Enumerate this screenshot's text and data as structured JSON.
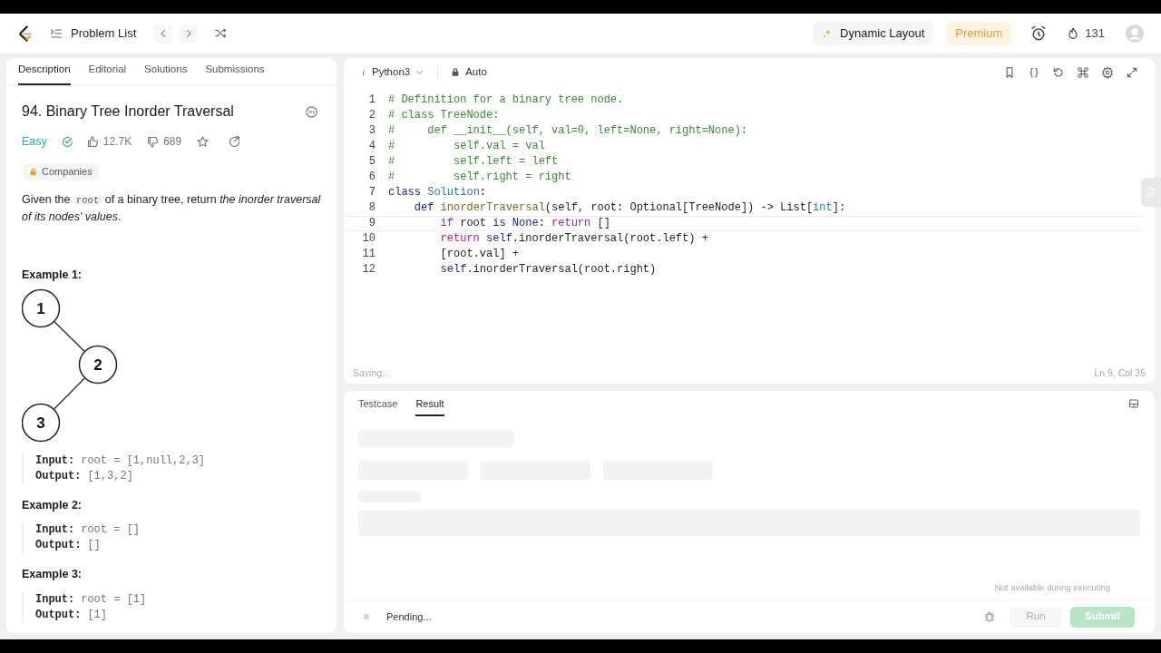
{
  "top_bar": {
    "problem_list": "Problem List",
    "dynamic_layout": "Dynamic Layout",
    "premium": "Premium",
    "streak": "131"
  },
  "description_panel": {
    "tabs": [
      {
        "label": "Description",
        "selected": true
      },
      {
        "label": "Editorial",
        "selected": false
      },
      {
        "label": "Solutions",
        "selected": false
      },
      {
        "label": "Submissions",
        "selected": false
      }
    ],
    "title": "94. Binary Tree Inorder Traversal",
    "difficulty": "Easy",
    "likes": "12.7K",
    "dislikes": "689",
    "companies": "Companies",
    "statement": [
      {
        "t": "Given the ",
        "kind": "text"
      },
      {
        "t": "root",
        "kind": "code"
      },
      {
        "t": " of a binary tree, return ",
        "kind": "text"
      },
      {
        "t": "the inorder traversal of its nodes' values",
        "kind": "italic"
      },
      {
        "t": ".",
        "kind": "text"
      }
    ],
    "examples": [
      {
        "heading": "Example 1:",
        "tree": [
          "1",
          "2",
          "3"
        ],
        "input_label": "Input:",
        "input": "root = [1,null,2,3]",
        "output_label": "Output:",
        "output": "[1,3,2]"
      },
      {
        "heading": "Example 2:",
        "input_label": "Input:",
        "input": "root = []",
        "output_label": "Output:",
        "output": "[]"
      },
      {
        "heading": "Example 3:",
        "input_label": "Input:",
        "input": "root = [1]",
        "output_label": "Output:",
        "output": "[1]"
      }
    ]
  },
  "editor": {
    "language": "Python3",
    "mode": "Auto",
    "lines": [
      {
        "number": "1",
        "active": false,
        "tokens": [
          {
            "t": "# Definition for a binary tree node.",
            "kind": "comment"
          }
        ]
      },
      {
        "number": "2",
        "active": false,
        "tokens": [
          {
            "t": "# class TreeNode:",
            "kind": "comment"
          }
        ]
      },
      {
        "number": "3",
        "active": false,
        "tokens": [
          {
            "t": "#     def __init__(self, val=0, left=None, right=None):",
            "kind": "comment"
          }
        ]
      },
      {
        "number": "4",
        "active": false,
        "tokens": [
          {
            "t": "#         self.val = val",
            "kind": "comment"
          }
        ]
      },
      {
        "number": "5",
        "active": false,
        "tokens": [
          {
            "t": "#         self.left = left",
            "kind": "comment"
          }
        ]
      },
      {
        "number": "6",
        "active": false,
        "tokens": [
          {
            "t": "#         self.right = right",
            "kind": "comment"
          }
        ]
      },
      {
        "number": "7",
        "active": false,
        "tokens": [
          {
            "t": "class",
            "kind": "keyword"
          },
          {
            "t": " Solution",
            "kind": "type"
          },
          {
            "t": ":",
            "kind": "plain"
          }
        ]
      },
      {
        "number": "8",
        "active": false,
        "tokens": [
          {
            "t": "    def",
            "kind": "keyword"
          },
          {
            "t": " inorderTraversal",
            "kind": "function"
          },
          {
            "t": "(self, root: Optional[TreeNode]) -> List[",
            "kind": "plain"
          },
          {
            "t": "int",
            "kind": "type"
          },
          {
            "t": "]:",
            "kind": "plain"
          }
        ]
      },
      {
        "number": "9",
        "active": true,
        "tokens": [
          {
            "t": "        if",
            "kind": "control"
          },
          {
            "t": " root ",
            "kind": "plain"
          },
          {
            "t": "is",
            "kind": "keyword"
          },
          {
            "t": " None",
            "kind": "keyword"
          },
          {
            "t": ": ",
            "kind": "plain"
          },
          {
            "t": "return",
            "kind": "control"
          },
          {
            "t": " []",
            "kind": "plain"
          }
        ]
      },
      {
        "number": "10",
        "active": false,
        "tokens": [
          {
            "t": "        return",
            "kind": "control"
          },
          {
            "t": " self",
            "kind": "keyword"
          },
          {
            "t": ".inorderTraversal(root.left) +",
            "kind": "plain"
          }
        ]
      },
      {
        "number": "11",
        "active": false,
        "tokens": [
          {
            "t": "        [root.val] +",
            "kind": "plain"
          }
        ]
      },
      {
        "number": "12",
        "active": false,
        "tokens": [
          {
            "t": "        self",
            "kind": "keyword"
          },
          {
            "t": ".inorderTraversal(root.right)",
            "kind": "plain"
          }
        ]
      }
    ],
    "save_status": "Saving...",
    "cursor_position": "Ln 9, Col 35"
  },
  "result_panel": {
    "tabs": [
      {
        "label": "Testcase",
        "selected": false
      },
      {
        "label": "Result",
        "selected": true
      }
    ],
    "hint": "Not available during executing",
    "status": "Pending...",
    "buttons": [
      {
        "label": "Run",
        "kind": "run",
        "disabled": true
      },
      {
        "label": "Submit",
        "kind": "submit",
        "disabled": true
      }
    ]
  }
}
